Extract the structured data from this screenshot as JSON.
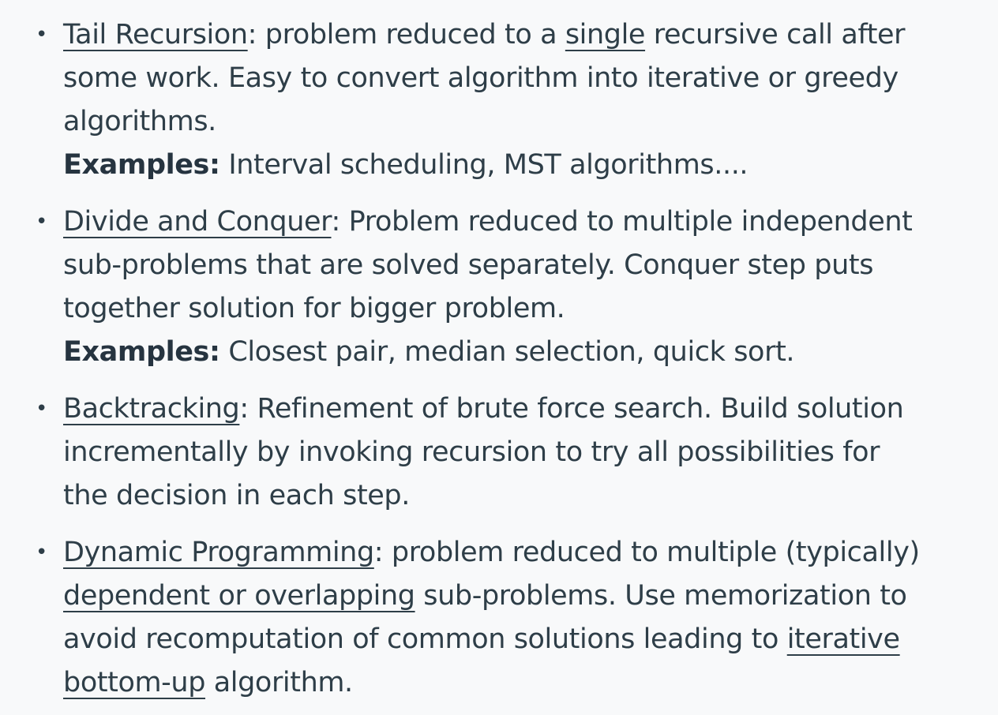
{
  "items": [
    {
      "term": "Tail Recursion",
      "lines": [
        {
          "after_term": ": problem reduced to a ",
          "underlined": "single",
          "rest": " recursive call after"
        },
        {
          "text": "some work. Easy to convert algorithm into iterative or greedy"
        },
        {
          "text": "algorithms."
        }
      ],
      "examples_label": "Examples:",
      "examples": " Interval scheduling, MST algorithms...."
    },
    {
      "term": "Divide and Conquer",
      "lines": [
        {
          "after_term": ": Problem reduced to multiple independent"
        },
        {
          "text": "sub-problems that are solved separately. Conquer step puts"
        },
        {
          "text": "together solution for bigger problem."
        }
      ],
      "examples_label": "Examples:",
      "examples": " Closest pair, median selection, quick sort."
    },
    {
      "term": "Backtracking",
      "lines": [
        {
          "after_term": ": Refinement of brute force search. Build solution"
        },
        {
          "text": "incrementally by invoking recursion to try all possibilities for"
        },
        {
          "text": "the decision in each step."
        }
      ]
    },
    {
      "term": "Dynamic Programming",
      "lines": [
        {
          "after_term": ": problem reduced to multiple (typically)"
        },
        {
          "underlined": "dependent or overlapping",
          "rest": " sub-problems. Use memorization to"
        },
        {
          "text": "avoid recomputation of common solutions leading to ",
          "underlined2": "iterative"
        },
        {
          "underlined": "bottom-up",
          "rest": " algorithm."
        }
      ]
    }
  ],
  "bullet_glyph": "•"
}
